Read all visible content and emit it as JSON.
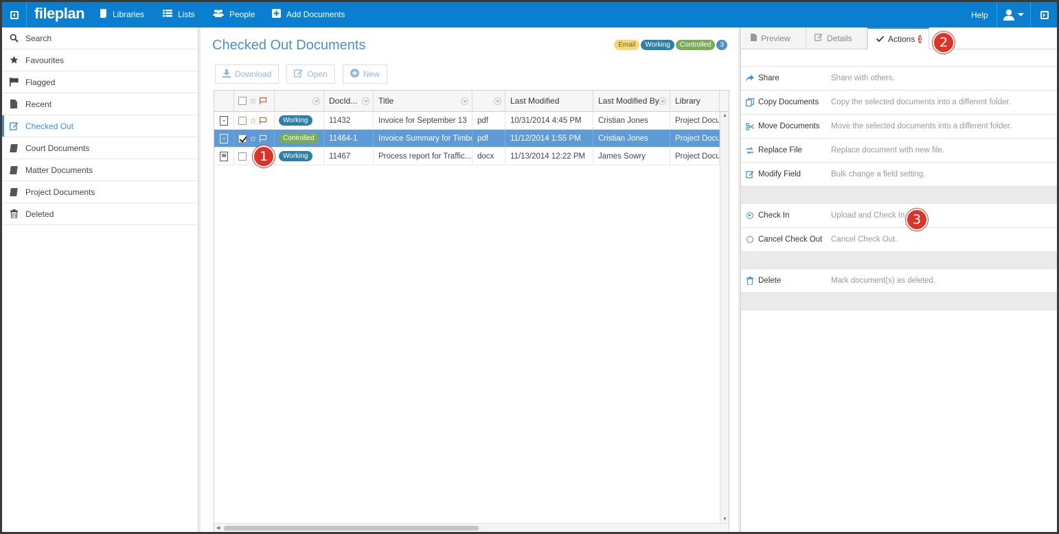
{
  "topbar": {
    "logo": "fileplan",
    "nav": [
      {
        "id": "libraries",
        "label": "Libraries",
        "icon": "book-icon"
      },
      {
        "id": "lists",
        "label": "Lists",
        "icon": "list-icon"
      },
      {
        "id": "people",
        "label": "People",
        "icon": "people-icon"
      },
      {
        "id": "add",
        "label": "Add Documents",
        "icon": "plus-square-icon"
      }
    ],
    "help": "Help"
  },
  "sidebar": {
    "items": [
      {
        "label": "Search",
        "icon": "search-icon"
      },
      {
        "label": "Favourites",
        "icon": "star-icon"
      },
      {
        "label": "Flagged",
        "icon": "flag-icon"
      },
      {
        "label": "Recent",
        "icon": "document-icon"
      },
      {
        "label": "Checked Out",
        "icon": "edit-icon",
        "active": true
      },
      {
        "label": "Court Documents",
        "icon": "book-icon"
      },
      {
        "label": "Matter Documents",
        "icon": "book-icon"
      },
      {
        "label": "Project Documents",
        "icon": "book-icon"
      },
      {
        "label": "Deleted",
        "icon": "trash-icon"
      }
    ]
  },
  "main": {
    "title": "Checked Out Documents",
    "legend": {
      "email": "Email",
      "working": "Working",
      "controlled": "Controlled",
      "count": "3"
    },
    "toolbar": {
      "download": "Download",
      "open": "Open",
      "new": "New"
    },
    "grid": {
      "headers": {
        "docid": "DocId...",
        "title": "Title",
        "last_modified": "Last Modified",
        "last_modified_by": "Last Modified By",
        "library": "Library"
      },
      "rows": [
        {
          "filetype_icon": "pdf-file-icon",
          "selected": false,
          "status": "Working",
          "docid": "11432",
          "title": "Invoice for September 13",
          "type": "pdf",
          "modified": "10/31/2014 4:45 PM",
          "by": "Cristian Jones",
          "library": "Project Documents"
        },
        {
          "filetype_icon": "pdf-file-icon",
          "selected": true,
          "status": "Controlled",
          "docid": "11464-1",
          "title": "Invoice Summary for Timber",
          "type": "pdf",
          "modified": "11/12/2014 1:55 PM",
          "by": "Cristian Jones",
          "library": "Project Documents"
        },
        {
          "filetype_icon": "word-file-icon",
          "selected": false,
          "status": "Working",
          "docid": "11467",
          "title": "Process report for Traffic...",
          "type": "docx",
          "modified": "11/13/2014 12:22 PM",
          "by": "James Sowry",
          "library": "Project Documents"
        }
      ]
    }
  },
  "right_panel": {
    "tabs": [
      {
        "label": "Preview",
        "icon": "document-icon"
      },
      {
        "label": "Details",
        "icon": "edit-icon"
      },
      {
        "label": "Actions",
        "icon": "check-icon",
        "badge": "1",
        "active": true
      }
    ],
    "actions": {
      "group1": [
        {
          "name": "Share",
          "desc": "Share with others.",
          "icon": "share-icon"
        },
        {
          "name": "Copy Documents",
          "desc": "Copy the selected documents into a different folder.",
          "icon": "copy-icon"
        },
        {
          "name": "Move Documents",
          "desc": "Move the selected documents into a different folder.",
          "icon": "scissors-icon"
        },
        {
          "name": "Replace File",
          "desc": "Replace document with new file.",
          "icon": "replace-icon"
        },
        {
          "name": "Modify Field",
          "desc": "Bulk change a field setting.",
          "icon": "edit-icon"
        }
      ],
      "group2": [
        {
          "name": "Check In",
          "desc": "Upload and Check In.",
          "icon": "check-in-icon"
        },
        {
          "name": "Cancel Check Out",
          "desc": "Cancel Check Out.",
          "icon": "circle-icon"
        }
      ],
      "group3": [
        {
          "name": "Delete",
          "desc": "Mark document(s) as deleted.",
          "icon": "trash-icon"
        }
      ]
    }
  },
  "callouts": [
    "1",
    "2",
    "3"
  ],
  "colors": {
    "brand": "#0a7fd0",
    "accent": "#3b8fd6",
    "working": "#2e7fa8",
    "controlled": "#7aab58",
    "email": "#f6d87a",
    "callout": "#d9352a",
    "selected_row": "#5e9ad6"
  }
}
